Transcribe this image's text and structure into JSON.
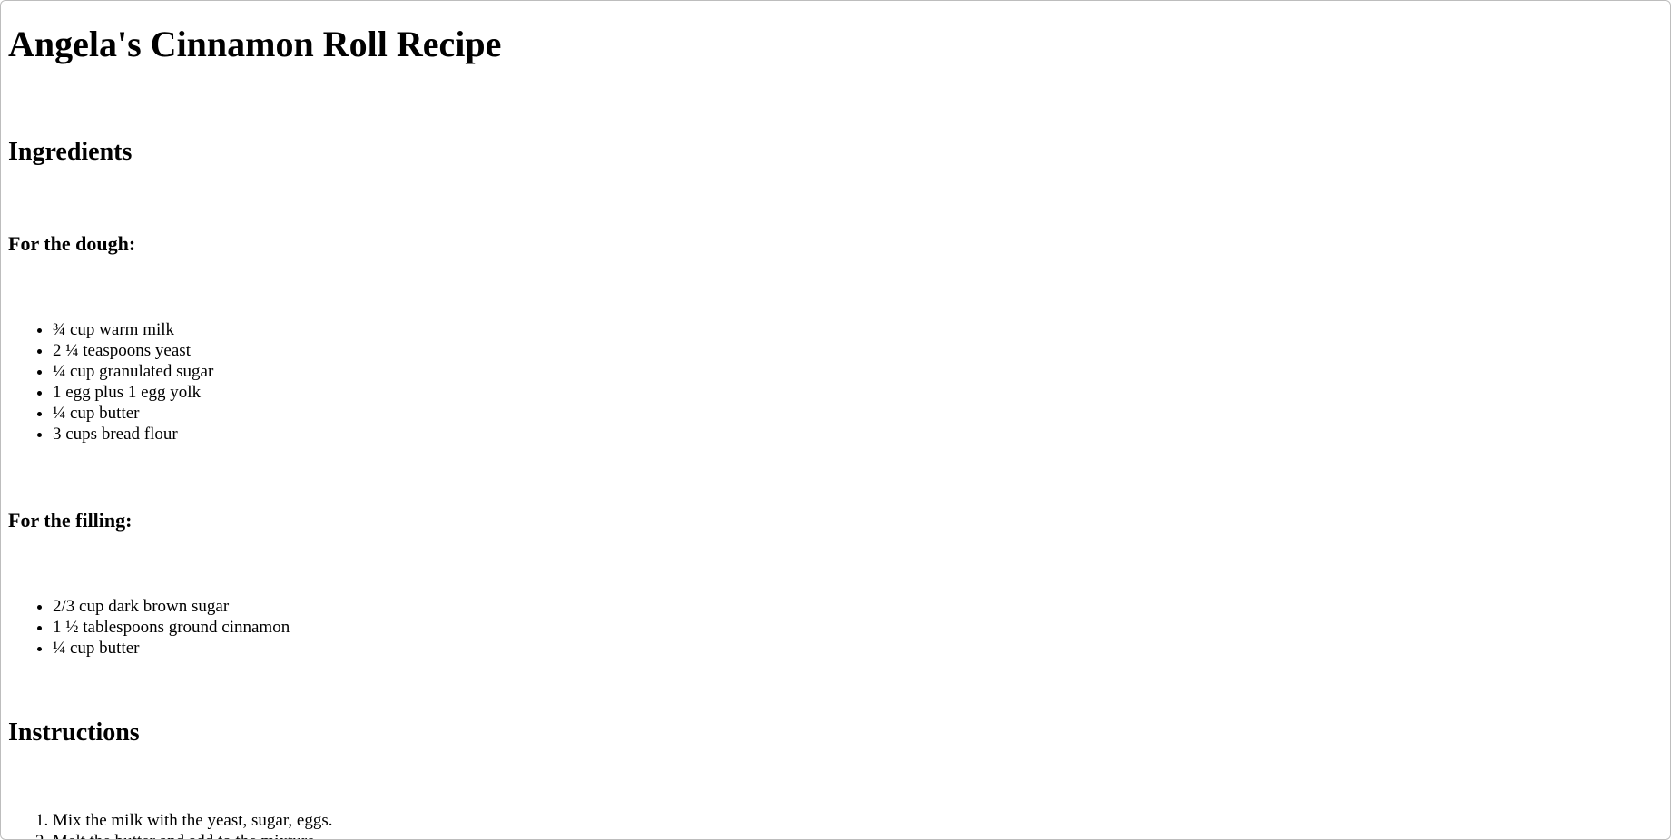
{
  "page": {
    "title": "Angela's Cinnamon Roll Recipe"
  },
  "ingredients": {
    "heading": "Ingredients",
    "dough": {
      "heading": "For the dough:",
      "items": [
        "¾ cup warm milk",
        "2 ¼ teaspoons yeast",
        "¼ cup granulated sugar",
        "1 egg plus 1 egg yolk",
        "¼ cup butter",
        "3 cups bread flour"
      ]
    },
    "filling": {
      "heading": "For the filling:",
      "items": [
        "2/3 cup dark brown sugar",
        "1 ½ tablespoons ground cinnamon",
        "¼ cup butter"
      ]
    }
  },
  "instructions": {
    "heading": "Instructions",
    "steps": [
      "Mix the milk with the yeast, sugar, eggs.",
      "Melt the butter and add to the mixture."
    ]
  }
}
